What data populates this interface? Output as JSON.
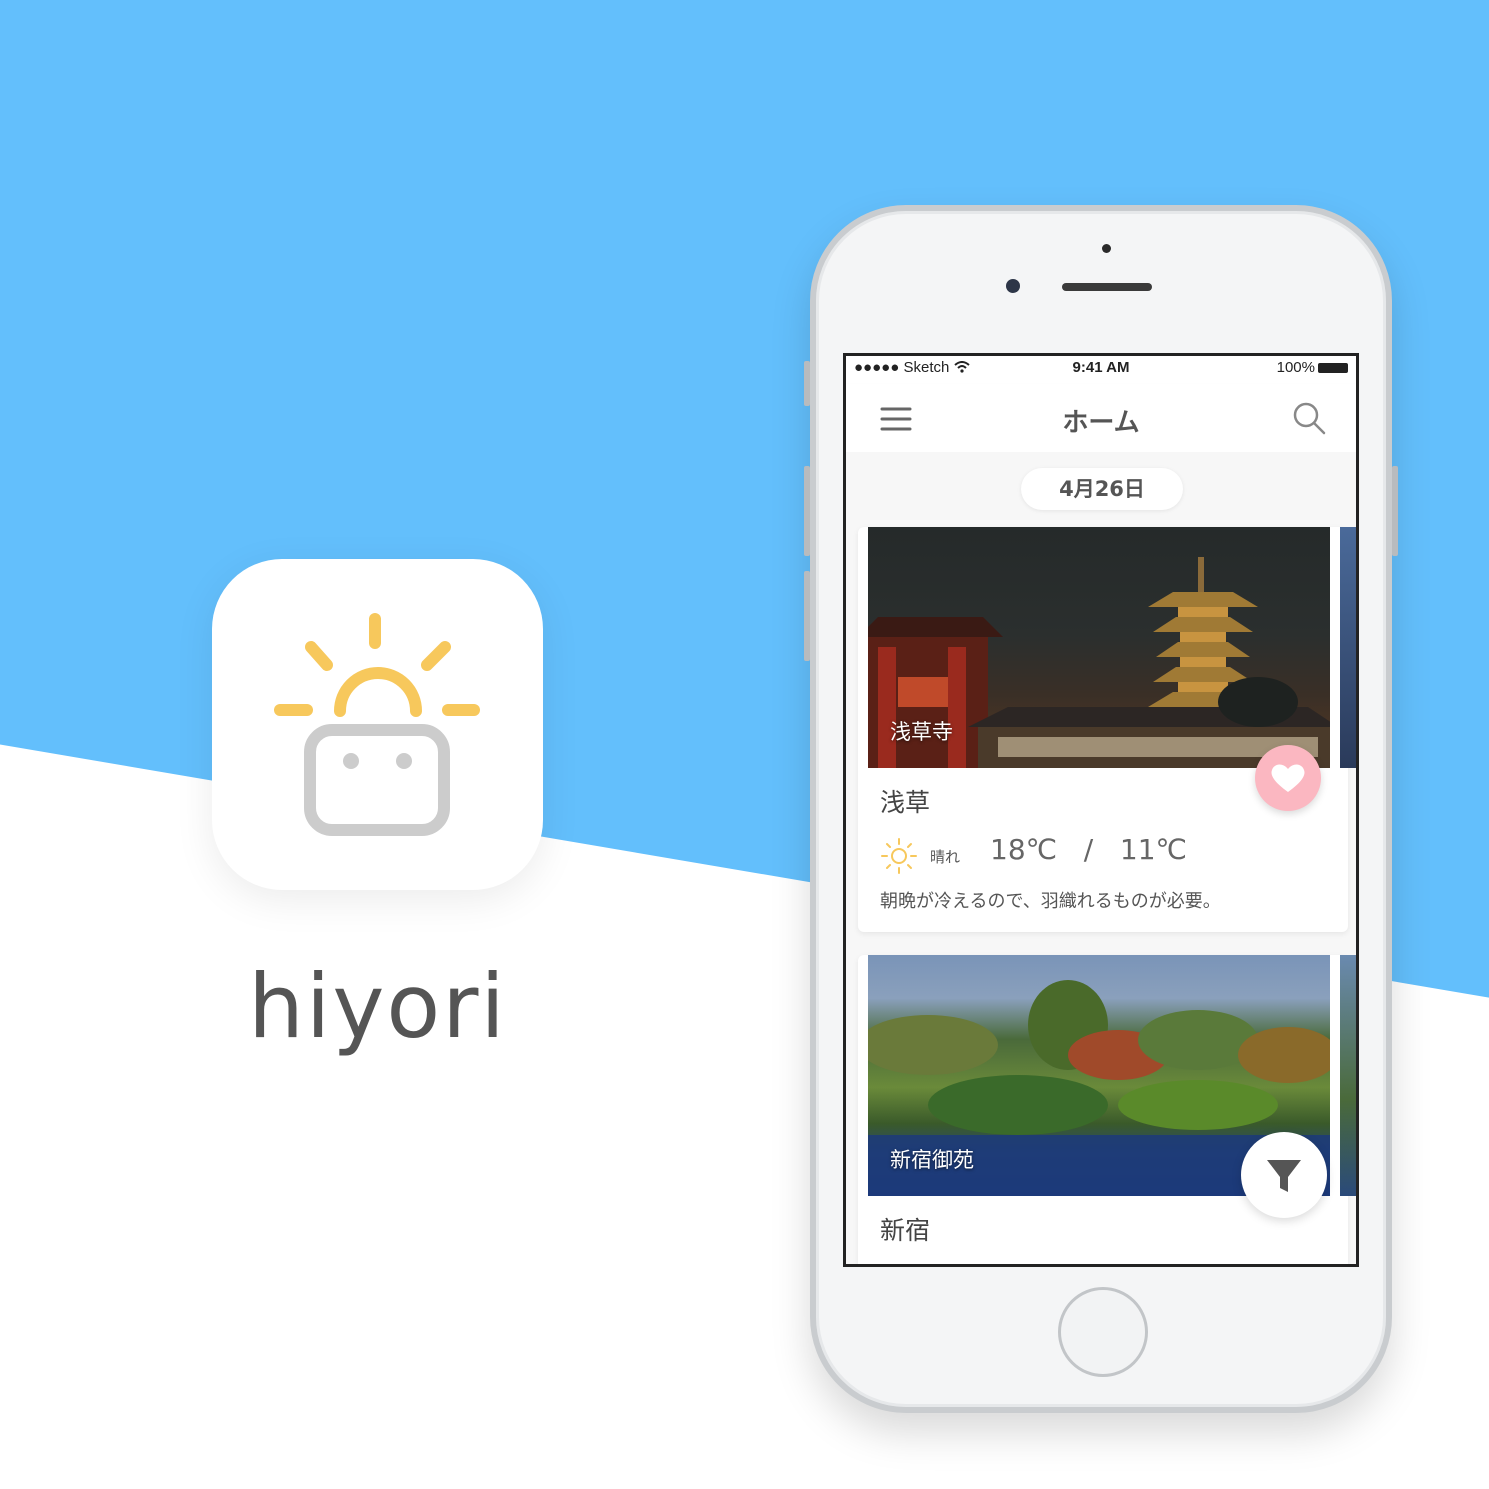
{
  "brand": {
    "app_name": "hiyori",
    "accent_blue": "#63bffc",
    "sun_color": "#f7c85c",
    "face_color": "#cccccc"
  },
  "status_bar": {
    "carrier": "●●●●● Sketch",
    "time": "9:41 AM",
    "battery": "100%"
  },
  "navbar": {
    "title": "ホーム",
    "menu_icon": "hamburger-menu-icon",
    "search_icon": "search-icon"
  },
  "date_label": "4月26日",
  "cards": [
    {
      "image_label": "浅草寺",
      "title": "浅草",
      "weather_icon": "sun-icon",
      "condition": "晴れ",
      "high": "18℃",
      "separator": "/",
      "low": "11℃",
      "description": "朝晩が冷えるので、羽織れるものが必要。",
      "favorite_icon": "heart-icon"
    },
    {
      "image_label": "新宿御苑",
      "title": "新宿"
    }
  ],
  "filter_button": {
    "icon": "filter-icon"
  }
}
